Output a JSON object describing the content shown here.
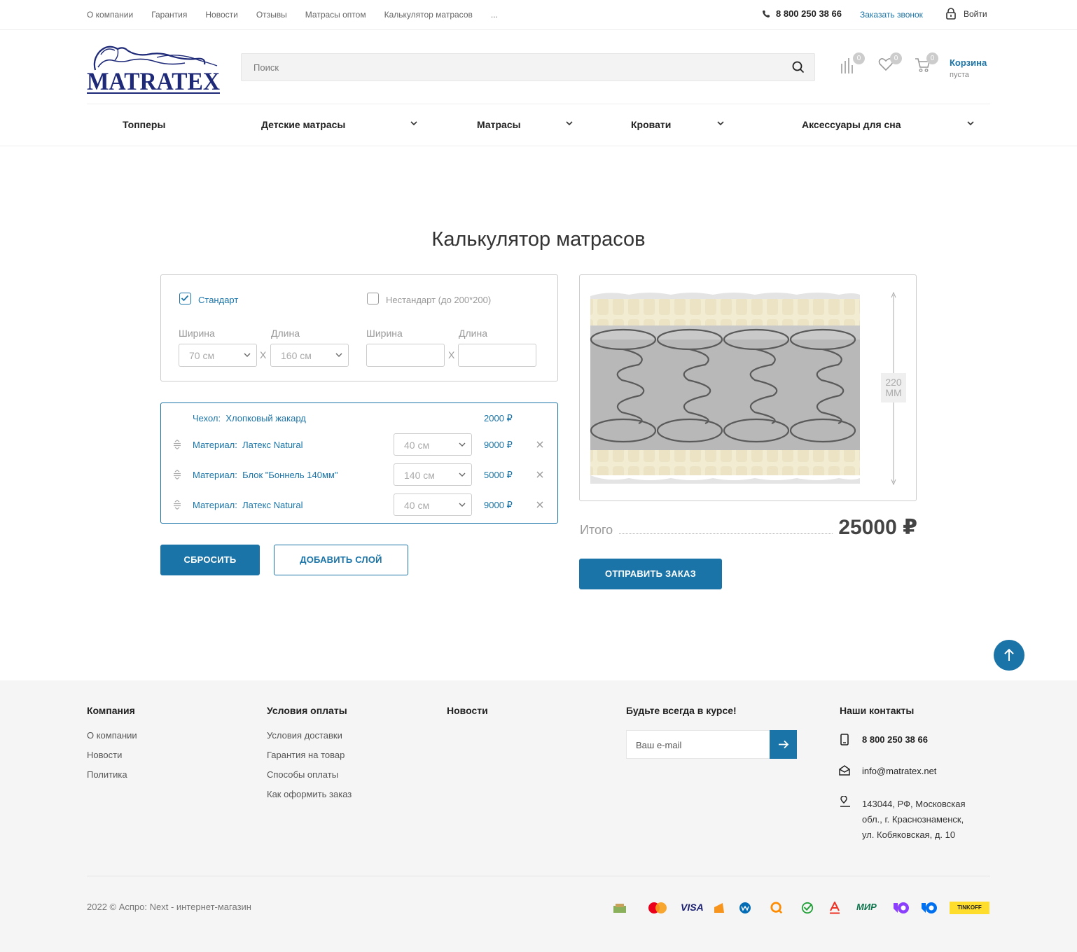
{
  "topbar": {
    "links": [
      "О компании",
      "Гарантия",
      "Новости",
      "Отзывы",
      "Матрасы оптом",
      "Калькулятор матрасов",
      "..."
    ],
    "phone": "8 800 250 38 66",
    "callback": "Заказать звонок",
    "login": "Войти"
  },
  "header": {
    "logo_text": "MATRATEX",
    "search_placeholder": "Поиск",
    "compare_count": "0",
    "wishlist_count": "0",
    "cart_count": "0",
    "cart_label": "Корзина",
    "cart_status": "пуста"
  },
  "nav": {
    "items": [
      "Топперы",
      "Детские матрасы",
      "Матрасы",
      "Кровати",
      "Аксессуары для сна"
    ]
  },
  "page": {
    "title": "Калькулятор матрасов"
  },
  "size": {
    "standard_label": "Стандарт",
    "standard_checked": true,
    "nonstandard_label": "Нестандарт (до 200*200)",
    "nonstandard_checked": false,
    "width_label": "Ширина",
    "length_label": "Длина",
    "width_value": "70 см",
    "length_value": "160 см",
    "times": "X"
  },
  "layers": {
    "cover": {
      "label": "Чехол:",
      "value": "Хлопковый жакард",
      "price": "2000 ₽"
    },
    "rows": [
      {
        "label": "Материал:",
        "value": "Латекс Natural",
        "thickness": "40 см",
        "price": "9000 ₽"
      },
      {
        "label": "Материал:",
        "value": "Блок \"Боннель 140мм\"",
        "thickness": "140 см",
        "price": "5000 ₽"
      },
      {
        "label": "Материал:",
        "value": "Латекс Natural",
        "thickness": "40 см",
        "price": "9000 ₽"
      }
    ]
  },
  "buttons": {
    "reset": "СБРОСИТЬ",
    "add_layer": "ДОБАВИТЬ СЛОЙ",
    "submit": "ОТПРАВИТЬ ЗАКАЗ"
  },
  "preview": {
    "height_value": "220",
    "height_unit": "ММ"
  },
  "total": {
    "label": "Итого",
    "value": "25000 ₽"
  },
  "footer": {
    "col1": {
      "title": "Компания",
      "links": [
        "О компании",
        "Новости",
        "Политика"
      ]
    },
    "col2": {
      "title": "Условия оплаты",
      "links": [
        "Условия доставки",
        "Гарантия на товар",
        "Способы оплаты",
        "Как оформить заказ"
      ]
    },
    "col3": {
      "title": "Новости"
    },
    "col4": {
      "title": "Будьте всегда в курсе!",
      "email_placeholder": "Ваш e-mail"
    },
    "col5": {
      "title": "Наши контакты",
      "phone": "8 800 250 38 66",
      "email": "info@matratex.net",
      "address_lines": [
        "143044, РФ, Московская",
        "обл., г. Краснознаменск,",
        "ул. Кобяковская, д. 10"
      ]
    },
    "copyright": "2022 © Аспро: Next - интернет-магазин",
    "payment_labels": {
      "visa": "VISA",
      "mir": "МИР",
      "tinkoff": "TINKOFF"
    }
  },
  "colors": {
    "accent": "#1a74a8",
    "text": "#333333",
    "muted": "#999999"
  }
}
